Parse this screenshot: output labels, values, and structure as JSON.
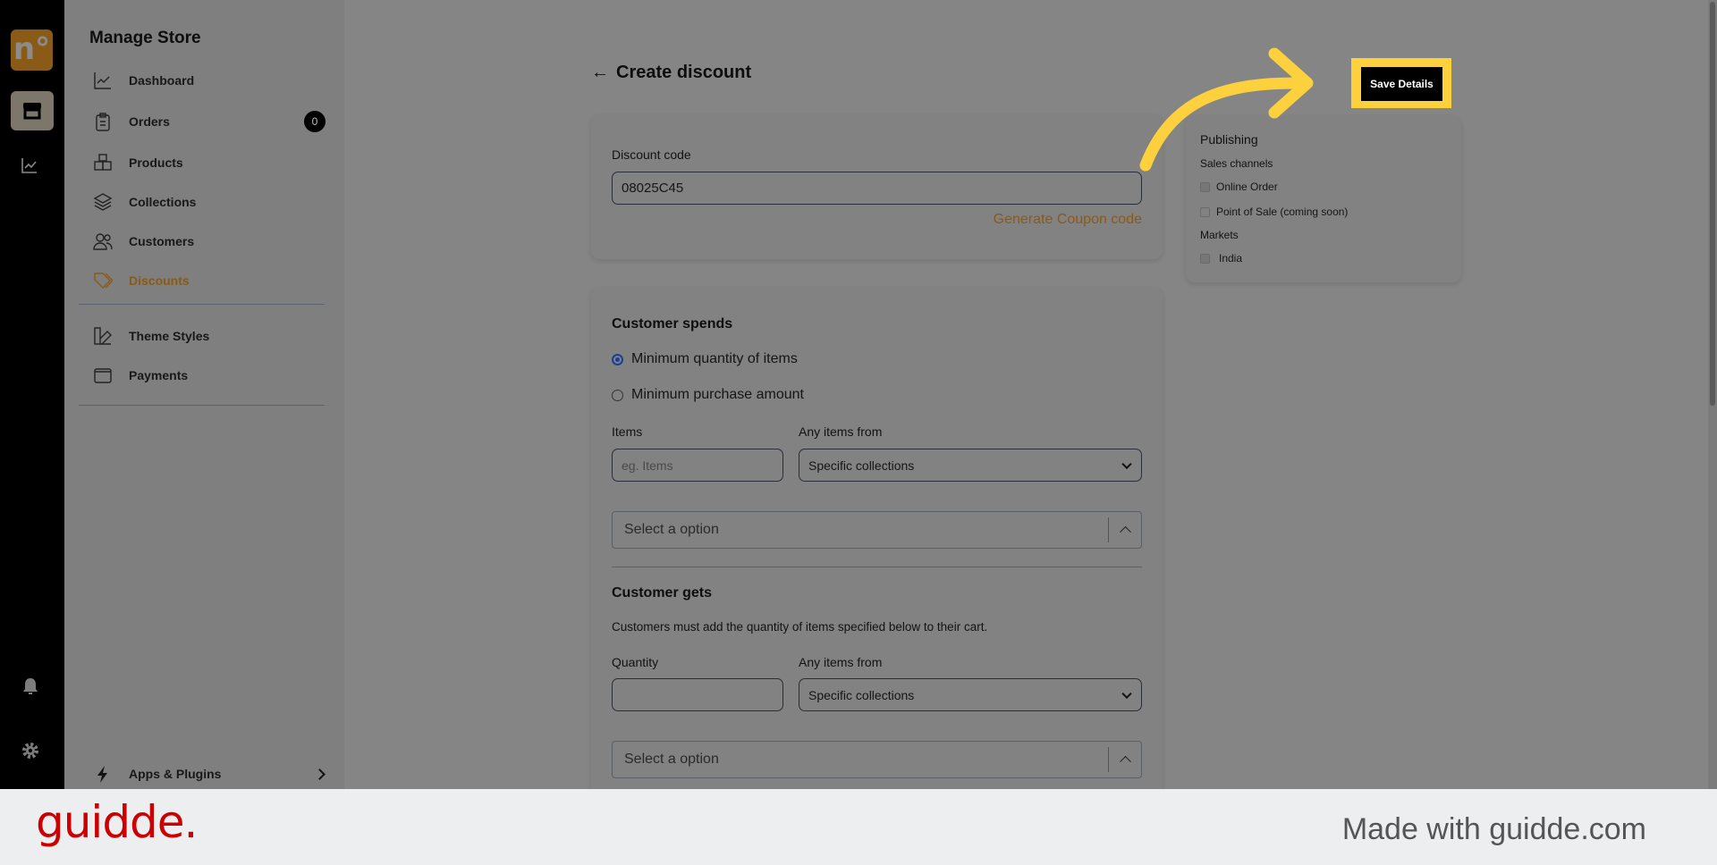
{
  "rail": {
    "logo": "n°",
    "icons": [
      "store-icon",
      "analytics-icon",
      "bell-icon",
      "gear-icon"
    ]
  },
  "sidebar": {
    "title": "Manage Store",
    "items": [
      {
        "label": "Dashboard",
        "icon": "chart-line-icon"
      },
      {
        "label": "Orders",
        "icon": "clipboard-icon",
        "badge": "0"
      },
      {
        "label": "Products",
        "icon": "boxes-icon"
      },
      {
        "label": "Collections",
        "icon": "layers-icon"
      },
      {
        "label": "Customers",
        "icon": "users-icon"
      },
      {
        "label": "Discounts",
        "icon": "tag-icon",
        "active": true
      },
      {
        "label": "Theme Styles",
        "icon": "palette-icon"
      },
      {
        "label": "Payments",
        "icon": "wallet-icon"
      }
    ],
    "apps": "Apps & Plugins"
  },
  "header": {
    "title": "Create discount",
    "back": "←"
  },
  "discount": {
    "label": "Discount code",
    "value": "08025C45",
    "generate": "Generate Coupon code"
  },
  "spends": {
    "title": "Customer spends",
    "options": [
      "Minimum quantity of items",
      "Minimum purchase amount"
    ],
    "selected": 0,
    "items_label": "Items",
    "items_placeholder": "eg. Items",
    "from_label": "Any items from",
    "from_value": "Specific collections",
    "select_placeholder": "Select a option"
  },
  "gets": {
    "title": "Customer gets",
    "desc": "Customers must add the quantity of items specified below to their cart.",
    "qty_label": "Quantity",
    "from_label": "Any items from",
    "from_value": "Specific collections",
    "select_placeholder": "Select a option"
  },
  "publishing": {
    "title": "Publishing",
    "channels_label": "Sales channels",
    "channels": [
      {
        "label": "Online Order",
        "checked": true
      },
      {
        "label": "Point of Sale (coming soon)",
        "checked": false
      }
    ],
    "markets_label": "Markets",
    "markets": [
      {
        "label": "India",
        "checked": true
      }
    ]
  },
  "save": "Save Details",
  "colors": {
    "accent": "#8a5a17",
    "highlight": "#fdd13d",
    "brand": "#cc0000"
  },
  "footer": {
    "brand": "guidde.",
    "made": "Made with guidde.com"
  }
}
